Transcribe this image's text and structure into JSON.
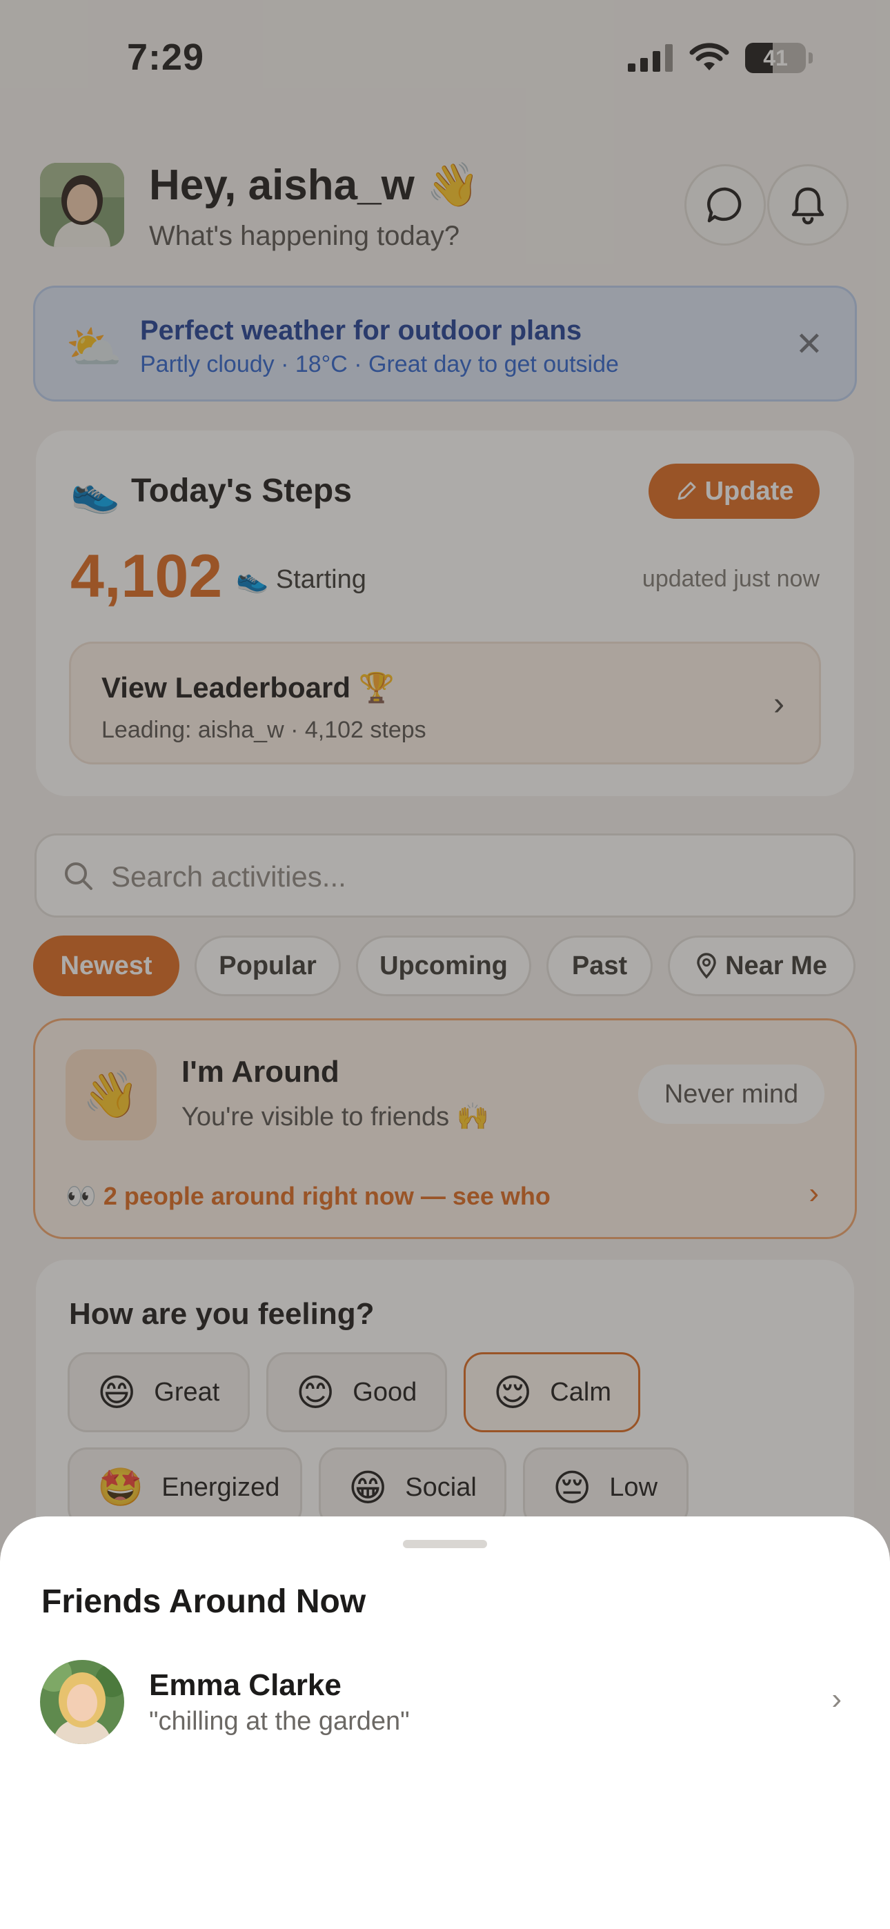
{
  "status_bar": {
    "time": "7:29",
    "battery": "41"
  },
  "header": {
    "greeting": "Hey, aisha_w 👋",
    "subtitle": "What's happening today?"
  },
  "weather": {
    "icon": "⛅",
    "title": "Perfect weather for outdoor plans",
    "subtitle": "Partly cloudy · 18°C · Great day to get outside",
    "close": "✕"
  },
  "steps": {
    "icon": "👟",
    "title": "Today's Steps",
    "update_label": "Update",
    "count": "4,102",
    "stage": "Starting",
    "stage_icon": "👟",
    "updated": "updated just now",
    "leaderboard_title": "View Leaderboard 🏆",
    "leaderboard_sub": "Leading: aisha_w · 4,102 steps"
  },
  "search": {
    "placeholder": "Search activities..."
  },
  "filters": [
    "Newest",
    "Popular",
    "Upcoming",
    "Past",
    "Near Me"
  ],
  "around": {
    "icon": "👋",
    "title": "I'm Around",
    "subtitle": "You're visible to friends 🙌",
    "never_mind": "Never mind",
    "who": "👀 2 people around right now — see who"
  },
  "feeling": {
    "title": "How are you feeling?",
    "moods": [
      {
        "emoji": "😄",
        "label": "Great"
      },
      {
        "emoji": "😊",
        "label": "Good"
      },
      {
        "emoji": "😌",
        "label": "Calm"
      },
      {
        "emoji": "🤩",
        "label": "Energized"
      },
      {
        "emoji": "😁",
        "label": "Social"
      },
      {
        "emoji": "😔",
        "label": "Low"
      }
    ],
    "selected": "Calm"
  },
  "sheet": {
    "title": "Friends Around Now",
    "friends": [
      {
        "name": "Emma Clarke",
        "status": "\"chilling at the garden\""
      }
    ]
  },
  "colors": {
    "accent": "#dd6a1f",
    "weather_title": "#1e3e96",
    "weather_sub": "#2b63cf"
  }
}
